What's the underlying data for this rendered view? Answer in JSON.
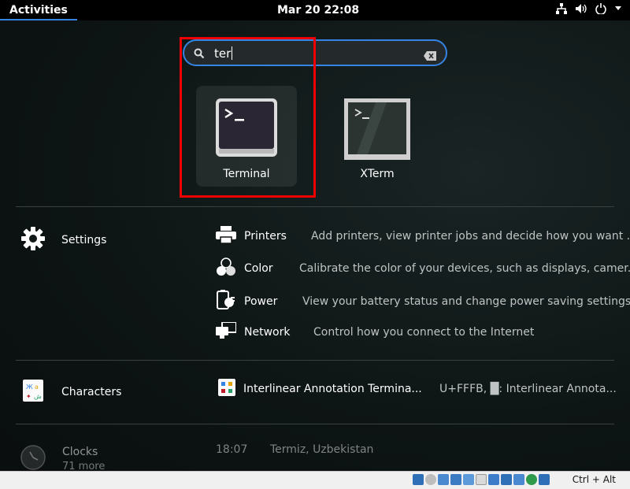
{
  "topbar": {
    "activities": "Activities",
    "clock": "Mar 20  22:08"
  },
  "search": {
    "value": "ter"
  },
  "apps": [
    {
      "label": "Terminal",
      "icon": "terminal-icon"
    },
    {
      "label": "XTerm",
      "icon": "xterm-icon"
    }
  ],
  "settings_provider": {
    "label": "Settings",
    "results": [
      {
        "name": "Printers",
        "desc": "Add printers, view printer jobs and decide how you want ...",
        "icon": "printer-icon"
      },
      {
        "name": "Color",
        "desc": "Calibrate the color of your devices, such as displays, camer...",
        "icon": "color-icon"
      },
      {
        "name": "Power",
        "desc": "View your battery status and change power saving settings",
        "icon": "power-icon"
      },
      {
        "name": "Network",
        "desc": "Control how you connect to the Internet",
        "icon": "network-icon"
      }
    ]
  },
  "characters_provider": {
    "label": "Characters",
    "result_name": "Interlinear Annotation Termina...",
    "result_desc": "U+FFFB, █: Interlinear Annota..."
  },
  "clocks_provider": {
    "label": "Clocks",
    "sublabel": "71 more",
    "time": "18:07",
    "place": "Termiz, Uzbekistan"
  },
  "vbox_status": {
    "hostkey": "Ctrl + Alt"
  },
  "colors": {
    "accent": "#3584e4",
    "highlight": "#ee0000"
  }
}
